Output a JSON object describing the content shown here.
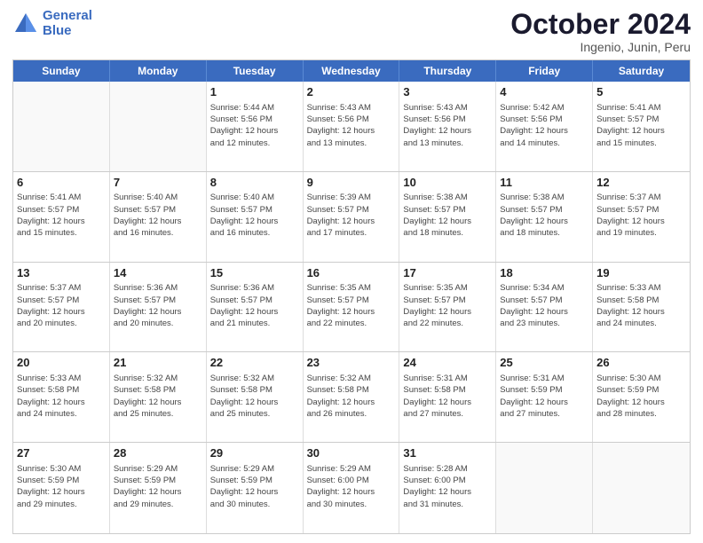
{
  "header": {
    "logo_line1": "General",
    "logo_line2": "Blue",
    "title": "October 2024",
    "subtitle": "Ingenio, Junin, Peru"
  },
  "days_of_week": [
    "Sunday",
    "Monday",
    "Tuesday",
    "Wednesday",
    "Thursday",
    "Friday",
    "Saturday"
  ],
  "weeks": [
    [
      {
        "day": "",
        "info": ""
      },
      {
        "day": "",
        "info": ""
      },
      {
        "day": "1",
        "info": "Sunrise: 5:44 AM\nSunset: 5:56 PM\nDaylight: 12 hours\nand 12 minutes."
      },
      {
        "day": "2",
        "info": "Sunrise: 5:43 AM\nSunset: 5:56 PM\nDaylight: 12 hours\nand 13 minutes."
      },
      {
        "day": "3",
        "info": "Sunrise: 5:43 AM\nSunset: 5:56 PM\nDaylight: 12 hours\nand 13 minutes."
      },
      {
        "day": "4",
        "info": "Sunrise: 5:42 AM\nSunset: 5:56 PM\nDaylight: 12 hours\nand 14 minutes."
      },
      {
        "day": "5",
        "info": "Sunrise: 5:41 AM\nSunset: 5:57 PM\nDaylight: 12 hours\nand 15 minutes."
      }
    ],
    [
      {
        "day": "6",
        "info": "Sunrise: 5:41 AM\nSunset: 5:57 PM\nDaylight: 12 hours\nand 15 minutes."
      },
      {
        "day": "7",
        "info": "Sunrise: 5:40 AM\nSunset: 5:57 PM\nDaylight: 12 hours\nand 16 minutes."
      },
      {
        "day": "8",
        "info": "Sunrise: 5:40 AM\nSunset: 5:57 PM\nDaylight: 12 hours\nand 16 minutes."
      },
      {
        "day": "9",
        "info": "Sunrise: 5:39 AM\nSunset: 5:57 PM\nDaylight: 12 hours\nand 17 minutes."
      },
      {
        "day": "10",
        "info": "Sunrise: 5:38 AM\nSunset: 5:57 PM\nDaylight: 12 hours\nand 18 minutes."
      },
      {
        "day": "11",
        "info": "Sunrise: 5:38 AM\nSunset: 5:57 PM\nDaylight: 12 hours\nand 18 minutes."
      },
      {
        "day": "12",
        "info": "Sunrise: 5:37 AM\nSunset: 5:57 PM\nDaylight: 12 hours\nand 19 minutes."
      }
    ],
    [
      {
        "day": "13",
        "info": "Sunrise: 5:37 AM\nSunset: 5:57 PM\nDaylight: 12 hours\nand 20 minutes."
      },
      {
        "day": "14",
        "info": "Sunrise: 5:36 AM\nSunset: 5:57 PM\nDaylight: 12 hours\nand 20 minutes."
      },
      {
        "day": "15",
        "info": "Sunrise: 5:36 AM\nSunset: 5:57 PM\nDaylight: 12 hours\nand 21 minutes."
      },
      {
        "day": "16",
        "info": "Sunrise: 5:35 AM\nSunset: 5:57 PM\nDaylight: 12 hours\nand 22 minutes."
      },
      {
        "day": "17",
        "info": "Sunrise: 5:35 AM\nSunset: 5:57 PM\nDaylight: 12 hours\nand 22 minutes."
      },
      {
        "day": "18",
        "info": "Sunrise: 5:34 AM\nSunset: 5:57 PM\nDaylight: 12 hours\nand 23 minutes."
      },
      {
        "day": "19",
        "info": "Sunrise: 5:33 AM\nSunset: 5:58 PM\nDaylight: 12 hours\nand 24 minutes."
      }
    ],
    [
      {
        "day": "20",
        "info": "Sunrise: 5:33 AM\nSunset: 5:58 PM\nDaylight: 12 hours\nand 24 minutes."
      },
      {
        "day": "21",
        "info": "Sunrise: 5:32 AM\nSunset: 5:58 PM\nDaylight: 12 hours\nand 25 minutes."
      },
      {
        "day": "22",
        "info": "Sunrise: 5:32 AM\nSunset: 5:58 PM\nDaylight: 12 hours\nand 25 minutes."
      },
      {
        "day": "23",
        "info": "Sunrise: 5:32 AM\nSunset: 5:58 PM\nDaylight: 12 hours\nand 26 minutes."
      },
      {
        "day": "24",
        "info": "Sunrise: 5:31 AM\nSunset: 5:58 PM\nDaylight: 12 hours\nand 27 minutes."
      },
      {
        "day": "25",
        "info": "Sunrise: 5:31 AM\nSunset: 5:59 PM\nDaylight: 12 hours\nand 27 minutes."
      },
      {
        "day": "26",
        "info": "Sunrise: 5:30 AM\nSunset: 5:59 PM\nDaylight: 12 hours\nand 28 minutes."
      }
    ],
    [
      {
        "day": "27",
        "info": "Sunrise: 5:30 AM\nSunset: 5:59 PM\nDaylight: 12 hours\nand 29 minutes."
      },
      {
        "day": "28",
        "info": "Sunrise: 5:29 AM\nSunset: 5:59 PM\nDaylight: 12 hours\nand 29 minutes."
      },
      {
        "day": "29",
        "info": "Sunrise: 5:29 AM\nSunset: 5:59 PM\nDaylight: 12 hours\nand 30 minutes."
      },
      {
        "day": "30",
        "info": "Sunrise: 5:29 AM\nSunset: 6:00 PM\nDaylight: 12 hours\nand 30 minutes."
      },
      {
        "day": "31",
        "info": "Sunrise: 5:28 AM\nSunset: 6:00 PM\nDaylight: 12 hours\nand 31 minutes."
      },
      {
        "day": "",
        "info": ""
      },
      {
        "day": "",
        "info": ""
      }
    ]
  ]
}
